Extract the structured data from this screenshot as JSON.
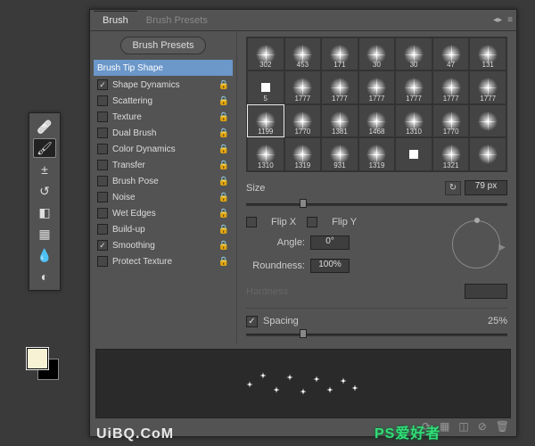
{
  "toolbox": {
    "tools": [
      {
        "name": "healing",
        "icon": "🩹"
      },
      {
        "name": "brush",
        "icon": "🖌",
        "selected": true
      },
      {
        "name": "stamp",
        "icon": "±"
      },
      {
        "name": "history",
        "icon": "↺"
      },
      {
        "name": "eraser",
        "icon": "◧"
      },
      {
        "name": "gradient",
        "icon": "▦"
      },
      {
        "name": "blur",
        "icon": "💧"
      },
      {
        "name": "dodge",
        "icon": "◐"
      }
    ],
    "fg": "#f8f2d5",
    "bg": "#000000"
  },
  "panel": {
    "tabs": {
      "brush": "Brush",
      "presets": "Brush Presets"
    },
    "menu_icons": [
      "◂▸",
      "≡"
    ],
    "preset_btn": "Brush Presets",
    "option_head": "Brush Tip Shape",
    "options": [
      {
        "label": "Shape Dynamics",
        "checked": true,
        "locked": true
      },
      {
        "label": "Scattering",
        "checked": false,
        "locked": true
      },
      {
        "label": "Texture",
        "checked": false,
        "locked": true
      },
      {
        "label": "Dual Brush",
        "checked": false,
        "locked": true
      },
      {
        "label": "Color Dynamics",
        "checked": false,
        "locked": true
      },
      {
        "label": "Transfer",
        "checked": false,
        "locked": true
      },
      {
        "label": "Brush Pose",
        "checked": false,
        "locked": true
      },
      {
        "label": "Noise",
        "checked": false,
        "locked": true
      },
      {
        "label": "Wet Edges",
        "checked": false,
        "locked": true
      },
      {
        "label": "Build-up",
        "checked": false,
        "locked": true
      },
      {
        "label": "Smoothing",
        "checked": true,
        "locked": true
      },
      {
        "label": "Protect Texture",
        "checked": false,
        "locked": true
      }
    ],
    "thumbs": [
      {
        "v": "302"
      },
      {
        "v": "453"
      },
      {
        "v": "171"
      },
      {
        "v": "30"
      },
      {
        "v": "30"
      },
      {
        "v": "47"
      },
      {
        "v": "131"
      },
      {
        "v": "5",
        "sq": true
      },
      {
        "v": "1777"
      },
      {
        "v": "1777"
      },
      {
        "v": "1777"
      },
      {
        "v": "1777"
      },
      {
        "v": "1777"
      },
      {
        "v": "1777"
      },
      {
        "v": "1199",
        "sel": true
      },
      {
        "v": "1770"
      },
      {
        "v": "1381"
      },
      {
        "v": "1468"
      },
      {
        "v": "1310"
      },
      {
        "v": "1770"
      },
      {
        "v": ""
      },
      {
        "v": "1310"
      },
      {
        "v": "1319"
      },
      {
        "v": "931"
      },
      {
        "v": "1319"
      },
      {
        "v": "",
        "sq": true
      },
      {
        "v": "1321"
      },
      {
        "v": ""
      }
    ],
    "size": {
      "label": "Size",
      "value": "79 px",
      "handle": 22
    },
    "flipx": "Flip X",
    "flipy": "Flip Y",
    "angle": {
      "label": "Angle:",
      "value": "0°"
    },
    "roundness": {
      "label": "Roundness:",
      "value": "100%"
    },
    "hardness": {
      "label": "Hardness",
      "value": ""
    },
    "spacing": {
      "label": "Spacing",
      "value": "25%",
      "checked": true,
      "handle": 22
    },
    "footer_icons": [
      "⟳",
      "▦",
      "◫",
      "⊘",
      "🗑"
    ]
  },
  "watermark": "UiBQ.CoM",
  "watermark_cn": "PS爱好者"
}
